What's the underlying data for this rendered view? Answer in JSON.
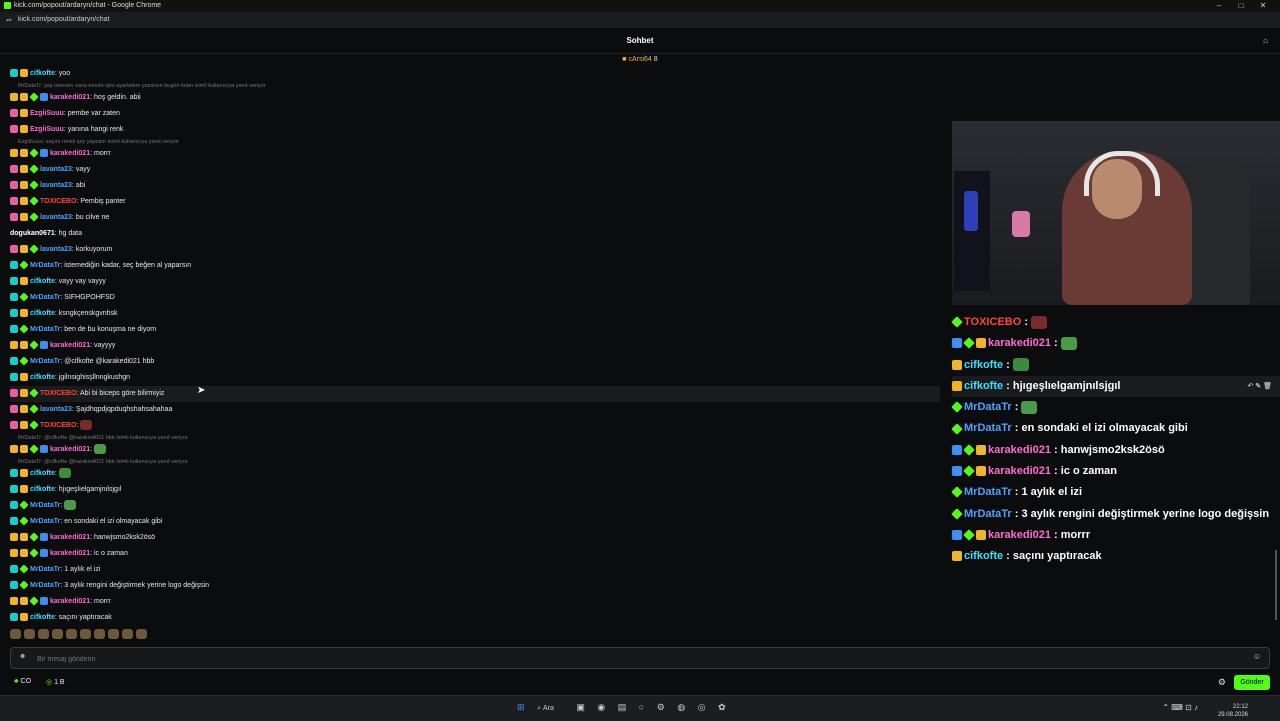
{
  "browser": {
    "window_title": "kick.com/popout/ardaryn/chat - Google Chrome",
    "url": "kick.com/popout/ardaryn/chat"
  },
  "chat_header": {
    "title": "Sohbet"
  },
  "pinned": {
    "user": "cArsi64",
    "count": "8"
  },
  "messages": [
    {
      "kind": "msg",
      "badges": [
        "teal",
        "gold"
      ],
      "user": "cifkofte",
      "uclass": "u-cyan",
      "text": "yoo"
    },
    {
      "kind": "reply",
      "text": "MrDataTr: şaş istersen sana emote işini ayarladım yazarsın bugün falan isimli kullanıcıya yanıt veriyor"
    },
    {
      "kind": "msg",
      "badges": [
        "gold",
        "gold",
        "green",
        "blue"
      ],
      "user": "karakedi021",
      "uclass": "u-pink",
      "text": "hoş geldin. abii"
    },
    {
      "kind": "msg",
      "badges": [
        "pink",
        "gold"
      ],
      "user": "EzgiiSuuu",
      "uclass": "u-pink",
      "text": "pembe var zaten"
    },
    {
      "kind": "msg",
      "badges": [
        "pink",
        "gold"
      ],
      "user": "EzgiiSuuu",
      "uclass": "u-pink",
      "text": "yanına hangi renk"
    },
    {
      "kind": "reply",
      "text": "EzgiiSuuu: saçını renkli şey yapcam isimli kullanıcıya yanıt veriyor"
    },
    {
      "kind": "msg",
      "badges": [
        "gold",
        "gold",
        "green",
        "blue"
      ],
      "user": "karakedi021",
      "uclass": "u-pink",
      "text": "morrr"
    },
    {
      "kind": "msg",
      "badges": [
        "pink",
        "gold",
        "green"
      ],
      "user": "lavanta23",
      "uclass": "u-blue",
      "text": "vayy"
    },
    {
      "kind": "msg",
      "badges": [
        "pink",
        "gold",
        "green"
      ],
      "user": "lavanta23",
      "uclass": "u-blue",
      "text": "abi"
    },
    {
      "kind": "msg",
      "badges": [
        "pink",
        "gold",
        "green"
      ],
      "user": "TOXICEBO",
      "uclass": "u-red",
      "text": "Pembiş panter"
    },
    {
      "kind": "msg",
      "badges": [
        "pink",
        "gold",
        "green"
      ],
      "user": "lavanta23",
      "uclass": "u-blue",
      "text": "bu cilve ne"
    },
    {
      "kind": "msg",
      "badges": [],
      "user": "dogukan0671",
      "uclass": "u-white",
      "text": "hg data"
    },
    {
      "kind": "msg",
      "badges": [
        "pink",
        "gold",
        "green"
      ],
      "user": "lavanta23",
      "uclass": "u-blue",
      "text": "korkuyorum"
    },
    {
      "kind": "msg",
      "badges": [
        "teal",
        "green"
      ],
      "user": "MrDataTr",
      "uclass": "u-blue",
      "text": "istemediğin kadar, seç beğen al yaparsın"
    },
    {
      "kind": "msg",
      "badges": [
        "teal",
        "gold"
      ],
      "user": "cifkofte",
      "uclass": "u-cyan",
      "text": "vayy vay vayyy"
    },
    {
      "kind": "msg",
      "badges": [
        "teal",
        "green"
      ],
      "user": "MrDataTr",
      "uclass": "u-blue",
      "text": "SIFHGPOHFSD"
    },
    {
      "kind": "msg",
      "badges": [
        "teal",
        "gold"
      ],
      "user": "cifkofte",
      "uclass": "u-cyan",
      "text": "ksngkçenskgvnhsk"
    },
    {
      "kind": "msg",
      "badges": [
        "teal",
        "green"
      ],
      "user": "MrDataTr",
      "uclass": "u-blue",
      "text": "ben de bu konuşma ne diyom"
    },
    {
      "kind": "msg",
      "badges": [
        "gold",
        "gold",
        "green",
        "blue"
      ],
      "user": "karakedi021",
      "uclass": "u-pink",
      "text": "vayyyy"
    },
    {
      "kind": "msg",
      "badges": [
        "teal",
        "green"
      ],
      "user": "MrDataTr",
      "uclass": "u-blue",
      "text": "@cifkofte @karakedi021 hbb"
    },
    {
      "kind": "msg",
      "badges": [
        "teal",
        "gold"
      ],
      "user": "cifkofte",
      "uclass": "u-cyan",
      "text": "jgilnsighisşllnngkushgn"
    },
    {
      "kind": "msg",
      "badges": [
        "pink",
        "gold",
        "green"
      ],
      "user": "TOXICEBO",
      "uclass": "u-red",
      "text": "Abi bi biceps göre bilirmiyiz",
      "hl": true
    },
    {
      "kind": "msg",
      "badges": [
        "pink",
        "gold",
        "green"
      ],
      "user": "lavanta23",
      "uclass": "u-blue",
      "text": "Şajdhqpdjqpduqhshahsahahaa"
    },
    {
      "kind": "msg",
      "badges": [
        "pink",
        "gold",
        "green"
      ],
      "user": "TOXICEBO",
      "uclass": "u-red",
      "text": "",
      "emote": "red"
    },
    {
      "kind": "reply",
      "text": "MrDataTr: @cifkofte @karakedi021 hbb isimli kullanıcıya yanıt veriyor"
    },
    {
      "kind": "msg",
      "badges": [
        "gold",
        "gold",
        "green",
        "blue"
      ],
      "user": "karakedi021",
      "uclass": "u-pink",
      "text": "",
      "emote": "pepe"
    },
    {
      "kind": "reply",
      "text": "MrDataTr: @cifkofte @karakedi021 hbb isimli kullanıcıya yanıt veriyor"
    },
    {
      "kind": "msg",
      "badges": [
        "teal",
        "gold"
      ],
      "user": "cifkofte",
      "uclass": "u-cyan",
      "text": "",
      "emote": "frog"
    },
    {
      "kind": "msg",
      "badges": [
        "teal",
        "gold"
      ],
      "user": "cifkofte",
      "uclass": "u-cyan",
      "text": "hjıgeşlıelgamjnılsjgıl"
    },
    {
      "kind": "msg",
      "badges": [
        "teal",
        "green"
      ],
      "user": "MrDataTr",
      "uclass": "u-blue",
      "text": "",
      "emote": "pepe"
    },
    {
      "kind": "msg",
      "badges": [
        "teal",
        "green"
      ],
      "user": "MrDataTr",
      "uclass": "u-blue",
      "text": "en sondaki el izi olmayacak gibi"
    },
    {
      "kind": "msg",
      "badges": [
        "gold",
        "gold",
        "green",
        "blue"
      ],
      "user": "karakedi021",
      "uclass": "u-pink",
      "text": "hanwjsmo2ksk2ösö"
    },
    {
      "kind": "msg",
      "badges": [
        "gold",
        "gold",
        "green",
        "blue"
      ],
      "user": "karakedi021",
      "uclass": "u-pink",
      "text": "ic o zaman"
    },
    {
      "kind": "msg",
      "badges": [
        "teal",
        "green"
      ],
      "user": "MrDataTr",
      "uclass": "u-blue",
      "text": "1 aylık el izi"
    },
    {
      "kind": "msg",
      "badges": [
        "teal",
        "green"
      ],
      "user": "MrDataTr",
      "uclass": "u-blue",
      "text": "3 aylık rengini değiştirmek yerine logo değişsin"
    },
    {
      "kind": "msg",
      "badges": [
        "gold",
        "gold",
        "green",
        "blue"
      ],
      "user": "karakedi021",
      "uclass": "u-pink",
      "text": "morrr"
    },
    {
      "kind": "msg",
      "badges": [
        "teal",
        "gold"
      ],
      "user": "cifkofte",
      "uclass": "u-cyan",
      "text": "saçını yaptıracak"
    }
  ],
  "overlay_messages": [
    {
      "badges": [
        "green"
      ],
      "user": "TOXICEBO",
      "uclass": "u-red",
      "text": "",
      "emote": "red"
    },
    {
      "badges": [
        "blue",
        "green",
        "gold"
      ],
      "user": "karakedi021",
      "uclass": "u-pink",
      "text": "",
      "emote": "pepe"
    },
    {
      "badges": [
        "gold"
      ],
      "user": "cifkofte",
      "uclass": "u-cyan",
      "text": "",
      "emote": "frog"
    },
    {
      "badges": [
        "gold"
      ],
      "user": "cifkofte",
      "uclass": "u-cyan",
      "text": "hjıgeşlıelgamjnılsjgıl",
      "hl": true
    },
    {
      "badges": [
        "green"
      ],
      "user": "MrDataTr",
      "uclass": "u-blue",
      "text": "",
      "emote": "pepe"
    },
    {
      "badges": [
        "green"
      ],
      "user": "MrDataTr",
      "uclass": "u-blue",
      "text": "en sondaki el izi olmayacak gibi"
    },
    {
      "badges": [
        "blue",
        "green",
        "gold"
      ],
      "user": "karakedi021",
      "uclass": "u-pink",
      "text": "hanwjsmo2ksk2ösö"
    },
    {
      "badges": [
        "blue",
        "green",
        "gold"
      ],
      "user": "karakedi021",
      "uclass": "u-pink",
      "text": "ic o zaman"
    },
    {
      "badges": [
        "green"
      ],
      "user": "MrDataTr",
      "uclass": "u-blue",
      "text": "1 aylık el izi"
    },
    {
      "badges": [
        "green"
      ],
      "user": "MrDataTr",
      "uclass": "u-blue",
      "text": "3 aylık rengini değiştirmek yerine logo değişsin"
    },
    {
      "badges": [
        "blue",
        "green",
        "gold"
      ],
      "user": "karakedi021",
      "uclass": "u-pink",
      "text": "morrr"
    },
    {
      "badges": [
        "gold"
      ],
      "user": "cifkofte",
      "uclass": "u-cyan",
      "text": "saçını yaptıracak"
    }
  ],
  "input": {
    "placeholder": "Bir mesaj gönderin"
  },
  "bottom": {
    "points_label": "CO",
    "points_value": "1 B",
    "send_label": "Gönder"
  },
  "taskbar": {
    "search_label": "Ara",
    "time": "22:12",
    "date": "29.08.2026"
  },
  "colors": {
    "accent": "#53fc18",
    "background": "#0b0c0d"
  }
}
